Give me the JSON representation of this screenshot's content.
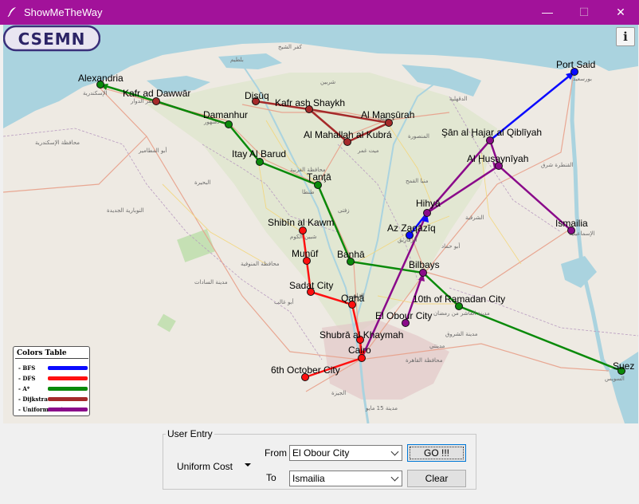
{
  "window": {
    "title": "ShowMeTheWay"
  },
  "titlebar_controls": {
    "minimize": "—",
    "maximize": "☐",
    "close": "✕"
  },
  "toolbar": {
    "info_label": "i",
    "logo_text": "CSEMN"
  },
  "legend": {
    "title": "Colors Table",
    "items": [
      {
        "label": "- BFS",
        "color": "#0a0aff"
      },
      {
        "label": "- DFS",
        "color": "#ff1010"
      },
      {
        "label": "- A*",
        "color": "#0a8a0a"
      },
      {
        "label": "- Dijkstra",
        "color": "#a52a2a"
      },
      {
        "label": "- Uniform cost",
        "color": "#8a0a8a"
      }
    ]
  },
  "cities": [
    {
      "name": "Alexandria"
    },
    {
      "name": "Kafr ad Dawwār"
    },
    {
      "name": "Damanhur"
    },
    {
      "name": "Disūq"
    },
    {
      "name": "Kafr ash Shaykh"
    },
    {
      "name": "Al Manşūrah"
    },
    {
      "name": "Al Mahallah al Kubrá"
    },
    {
      "name": "Itay Al Barud"
    },
    {
      "name": "Ţanţā"
    },
    {
      "name": "Shibīn al Kawm"
    },
    {
      "name": "Munūf"
    },
    {
      "name": "Banhā"
    },
    {
      "name": "Sadat City"
    },
    {
      "name": "Qahā"
    },
    {
      "name": "Shubrā al Khaymah"
    },
    {
      "name": "Cairo"
    },
    {
      "name": "6th October City"
    },
    {
      "name": "Az Zaqāzīq"
    },
    {
      "name": "Hihyā"
    },
    {
      "name": "Bilbays"
    },
    {
      "name": "10th of Ramadan City"
    },
    {
      "name": "El Obour City"
    },
    {
      "name": "Port Said"
    },
    {
      "name": "Şān al Ḩajar al Qiblīyah"
    },
    {
      "name": "Al Ḩusaynīyah"
    },
    {
      "name": "Ismailia"
    },
    {
      "name": "Suez"
    }
  ],
  "map_arabic_labels": [
    "كفر الشيخ",
    "بلطيم",
    "الدقهلية",
    "الإسكندرية",
    "كفر الدوار",
    "دمنهور",
    "محافظة الإسكندرية",
    "أبو المطامير",
    "البحيرة",
    "النوبارية الجديدة",
    "محافظة الغربية",
    "طنطا",
    "شبين الكوم",
    "محافظة المنوفية",
    "مدينة السادات",
    "الشرقية",
    "الزقازيق",
    "مدينة العاشر من رمضان",
    "بورسعيد",
    "الإسماعيلية",
    "محافظة القاهرة",
    "مدينة 15 مايو",
    "السويس",
    "القنطرة شرق",
    "منيا القمح",
    "أبو حماد",
    "طلخا",
    "المنصورة",
    "شربين",
    "القليوبية",
    "الجيزة",
    "أبو غالب",
    "مدينة الشروق",
    "مدينتي",
    "ميت غمر",
    "زفتى"
  ],
  "user_entry": {
    "legend": "User Entry",
    "algorithm": "Uniform Cost",
    "from_label": "From",
    "from_value": "El Obour City",
    "to_label": "To",
    "to_value": "Ismailia",
    "go_label": "GO !!!",
    "clear_label": "Clear"
  }
}
